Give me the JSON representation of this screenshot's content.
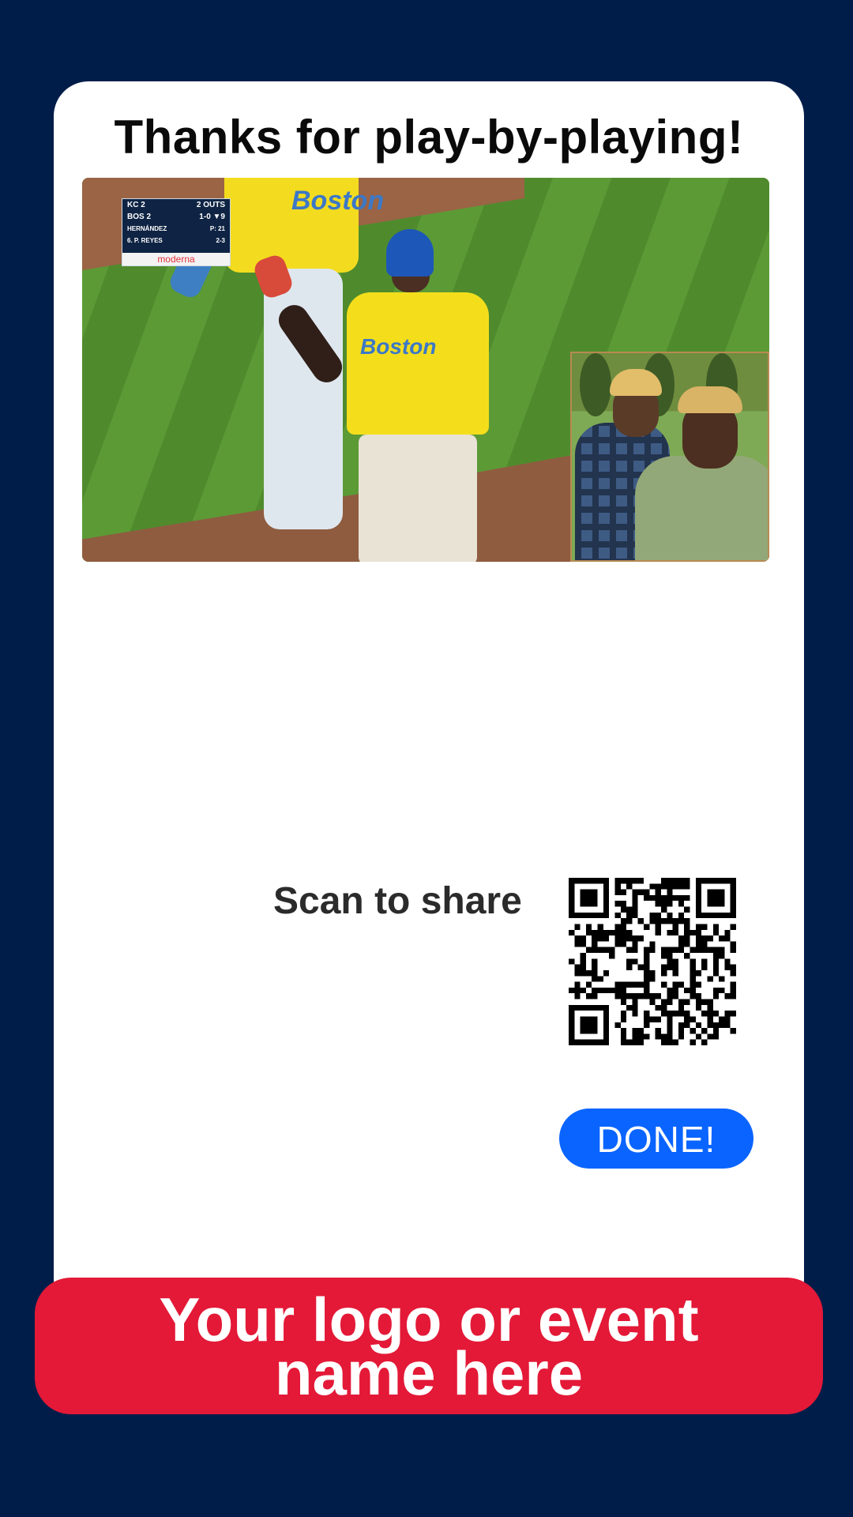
{
  "header": {
    "title": "Thanks for play-by-playing!"
  },
  "video": {
    "jersey_text": "Boston",
    "scorebug": {
      "rows": [
        {
          "left": "KC  2",
          "right": "2 OUTS"
        },
        {
          "left": "BOS 2",
          "right": "1-0  ▼9"
        },
        {
          "left": "HERNÁNDEZ",
          "right": "P: 21"
        },
        {
          "left": "6. P. REYES",
          "right": "2-3"
        }
      ],
      "sponsor": "moderna"
    }
  },
  "share": {
    "label": "Scan to share",
    "qr_icon": "qr-code-icon"
  },
  "actions": {
    "done_label": "DONE!"
  },
  "footer": {
    "banner_text": "Your logo or event name here"
  },
  "colors": {
    "background": "#001d4a",
    "card": "#ffffff",
    "done_button": "#0a64ff",
    "banner": "#e31937"
  }
}
